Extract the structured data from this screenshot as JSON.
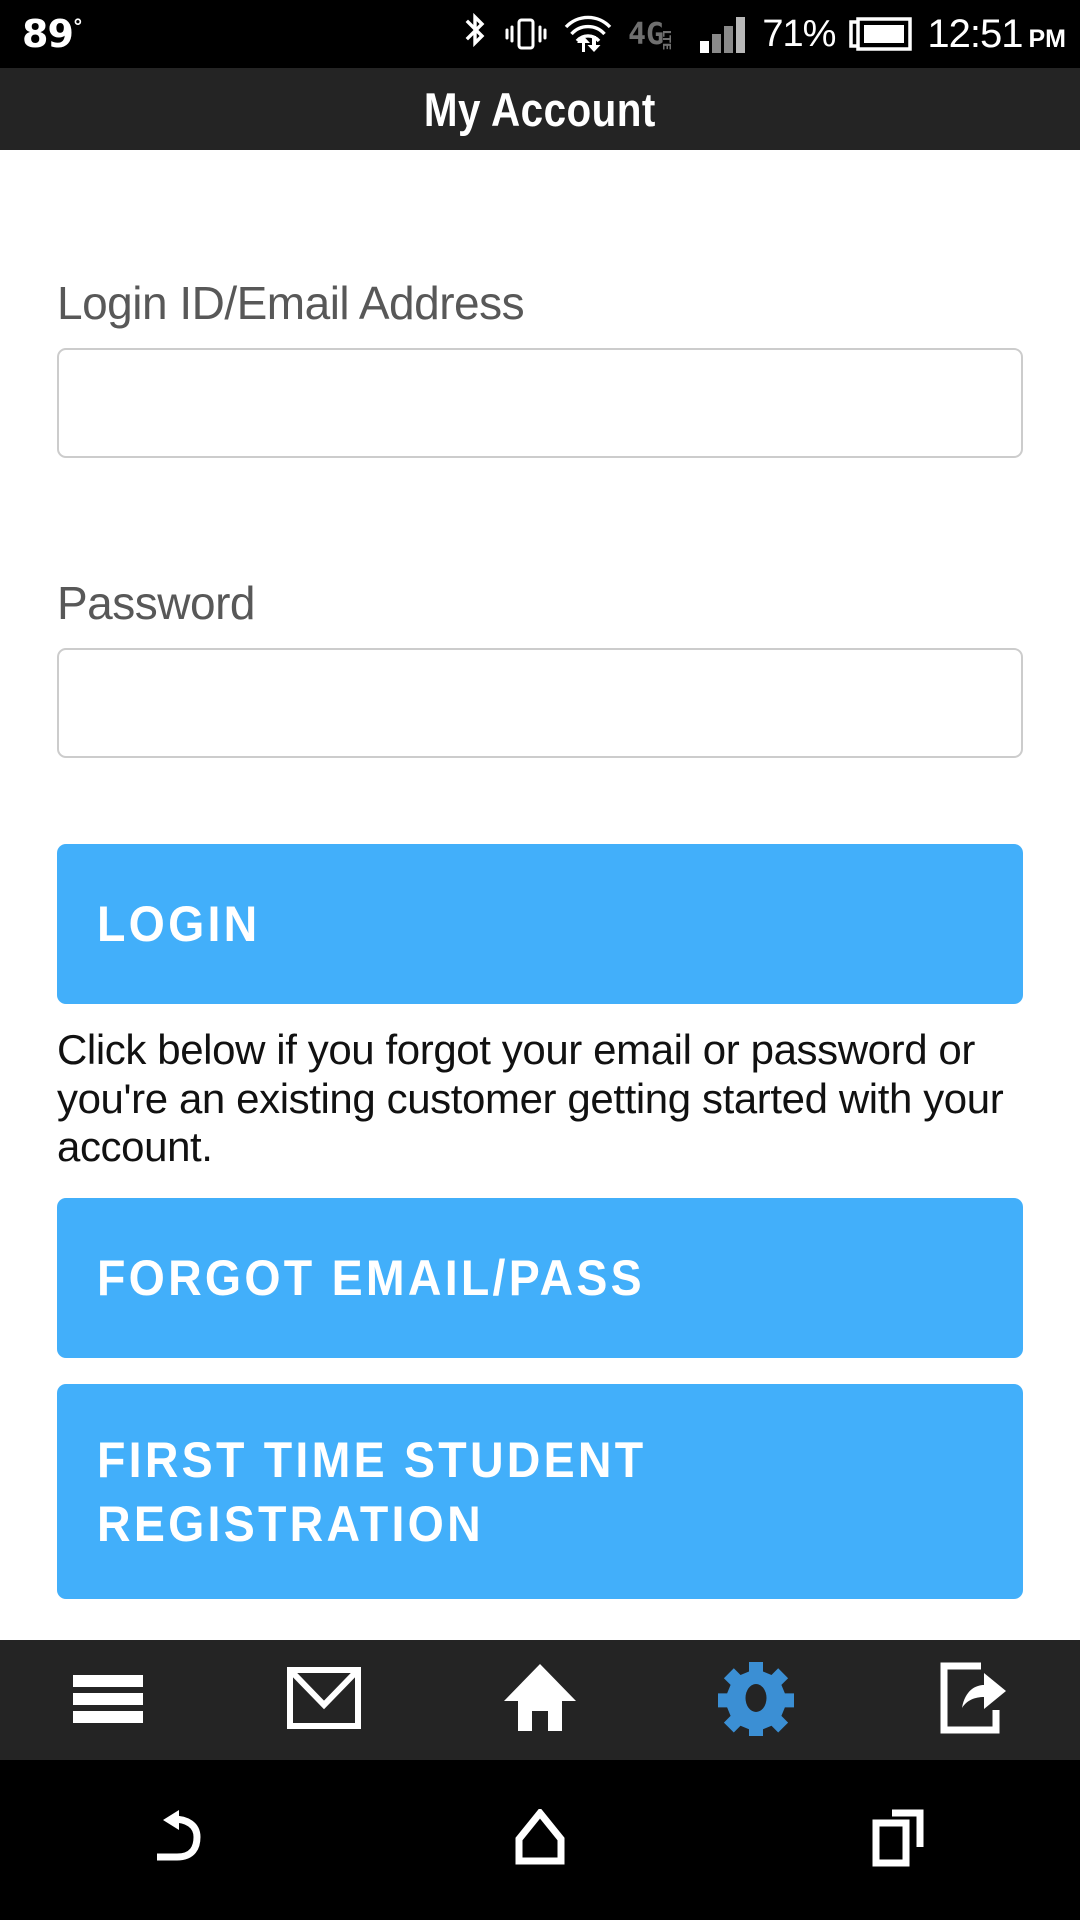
{
  "statusbar": {
    "temperature": "89",
    "temperature_unit": "°",
    "battery_percent": "71%",
    "time": "12:51",
    "ampm": "PM",
    "network_label": "4G",
    "network_sub": "LTE",
    "icons": [
      "bluetooth-icon",
      "vibrate-icon",
      "wifi-transfer-icon",
      "network-4glte-icon",
      "signal-bars-icon",
      "battery-icon"
    ]
  },
  "titlebar": {
    "title": "My Account"
  },
  "form": {
    "login_label": "Login ID/Email Address",
    "login_value": "",
    "login_placeholder": "",
    "password_label": "Password",
    "password_value": "",
    "password_placeholder": "",
    "login_button": "LOGIN",
    "helper_text": "Click below if you forgot your email or password or you're an existing customer getting started with your account.",
    "forgot_button": "FORGOT EMAIL/PASS",
    "register_button": "FIRST TIME STUDENT REGISTRATION"
  },
  "appnav": {
    "items": [
      {
        "name": "menu",
        "icon": "hamburger-menu-icon",
        "active": false
      },
      {
        "name": "mail",
        "icon": "envelope-icon",
        "active": false
      },
      {
        "name": "home",
        "icon": "home-icon",
        "active": false
      },
      {
        "name": "settings",
        "icon": "gear-icon",
        "active": true
      },
      {
        "name": "share",
        "icon": "share-icon",
        "active": false
      }
    ]
  },
  "sysnav": {
    "items": [
      {
        "name": "back",
        "icon": "back-arrow-icon"
      },
      {
        "name": "home",
        "icon": "home-outline-icon"
      },
      {
        "name": "recents",
        "icon": "recents-squares-icon"
      }
    ]
  },
  "colors": {
    "accent_blue": "#42AFFA",
    "gear_blue": "#3B8FD4",
    "titlebar_bg": "#242424",
    "statusbar_bg": "#000000",
    "label_gray": "#585858",
    "input_border": "#cccccc"
  }
}
